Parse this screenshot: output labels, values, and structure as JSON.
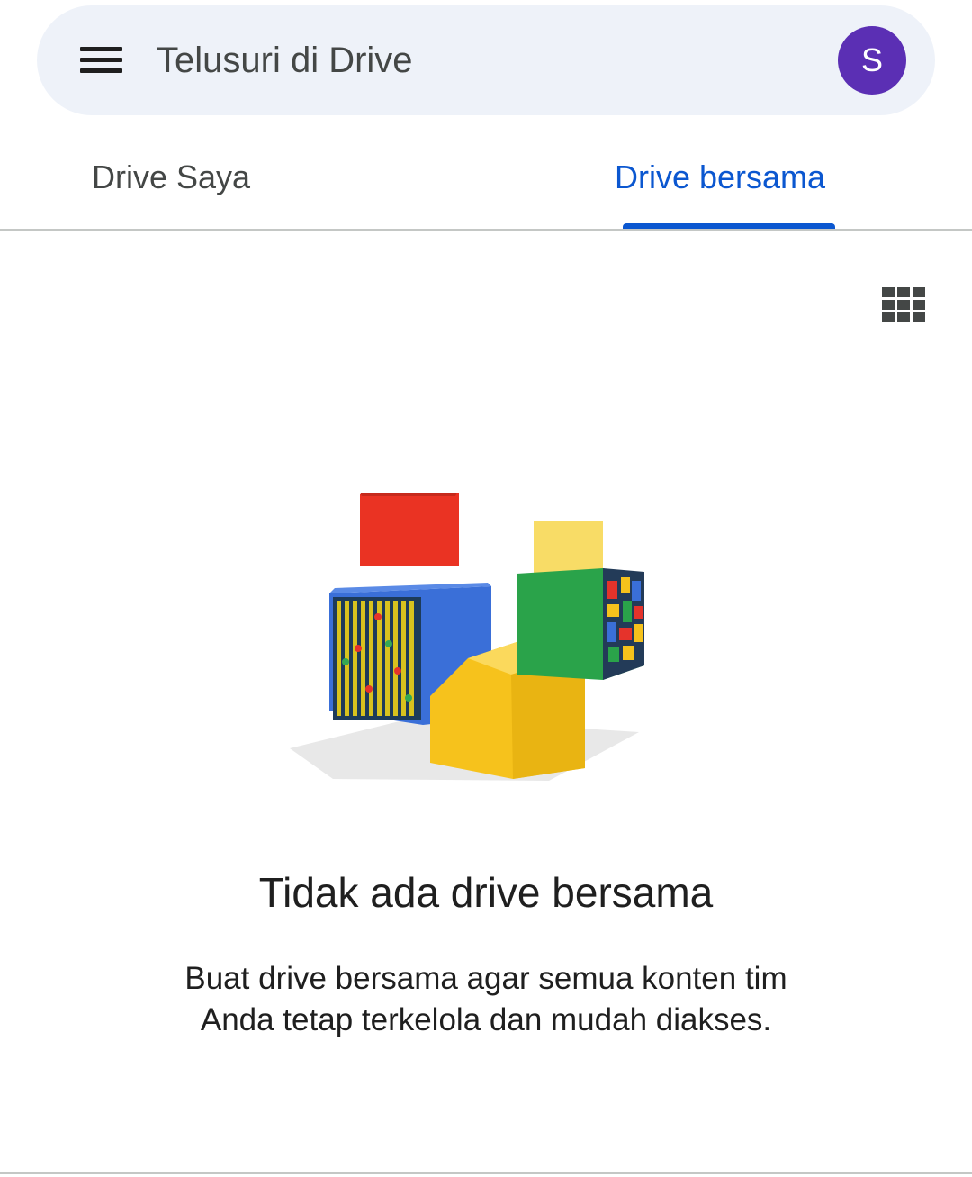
{
  "search": {
    "placeholder": "Telusuri di Drive"
  },
  "account": {
    "avatar_letter": "S",
    "avatar_color": "#5b2fb4"
  },
  "tabs": [
    {
      "label": "Drive Saya",
      "active": false
    },
    {
      "label": "Drive bersama",
      "active": true
    }
  ],
  "toolbar": {
    "view_icon": "grid-view-icon"
  },
  "empty_state": {
    "title": "Tidak ada drive bersama",
    "description": "Buat drive bersama agar semua konten tim Anda tetap terkelola dan mudah diakses.",
    "illustration": "colorful-cubes"
  },
  "colors": {
    "accent": "#0b57d0",
    "search_bg": "#eef2f9",
    "divider": "#c4c7c5"
  }
}
